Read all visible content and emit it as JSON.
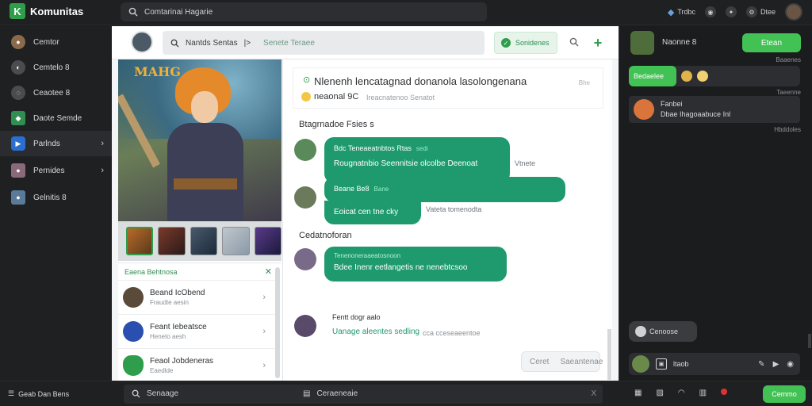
{
  "app": {
    "name": "Komunitas",
    "logo_glyph": "K"
  },
  "top_search": {
    "placeholder": "Comtarinai Hagarie"
  },
  "top_actions": [
    {
      "label": "Trdbc",
      "icon": "gamepad-icon"
    },
    {
      "label": "",
      "icon": "chat-icon"
    },
    {
      "label": "",
      "icon": "discover-icon"
    },
    {
      "label": "Dtee",
      "icon": "settings-icon"
    }
  ],
  "left_nav": [
    {
      "label": "Cemtor",
      "icon": "user-icon",
      "active": false
    },
    {
      "label": "Cemtelo 8",
      "icon": "chat-icon",
      "active": false
    },
    {
      "label": "Ceaotee 8",
      "icon": "star-icon",
      "active": false
    },
    {
      "label": "Daote Semde",
      "icon": "cube-icon",
      "active": false
    },
    {
      "label": "Parlnds",
      "icon": "game-icon",
      "active": true,
      "chevron": true
    },
    {
      "label": "Pernides",
      "icon": "avatar-icon",
      "active": false,
      "chevron": true
    },
    {
      "label": "Gelnitis 8",
      "icon": "avatar-icon",
      "active": false
    }
  ],
  "chat_header": {
    "title": "Nantds Sentas",
    "sep": "|>",
    "subtitle": "Senete Teraee",
    "green_button": "Sonidenes",
    "plus": "+"
  },
  "media": {
    "hero_title": "MAHG",
    "prompt": "Eaena Behtnosa",
    "contacts": [
      {
        "name": "Beand IcObend",
        "sub": "Fraudte aesin"
      },
      {
        "name": "Feant Iebeatsce",
        "sub": "Heneto aesh"
      },
      {
        "name": "Feaol Jobdeneras",
        "sub": "Eaedlde"
      }
    ]
  },
  "pinned": {
    "line1": "Nlenenh lencatagnad donanola lasolongenana",
    "line2": "neaonal 9C",
    "line2b": "Ireacnatenoo Senatot",
    "tag": "Bhe"
  },
  "messages": {
    "section1": "Btagrnadoe Fsies s",
    "bubble1_head": "Bdc",
    "bubble1_head2": "Teneaeatnbtos Rtas",
    "bubble1_tag": "sedi",
    "bubble1_text": "Rougnatnbio Seennitsie olcolbe Deenoat",
    "bubble1_meta": "Vtnete",
    "bubble2_head": "Beane Be8",
    "bubble2_tag": "Bane",
    "bubble2_text": "Eoicat cen tne cky",
    "bubble2_meta": "Vateta tomenodta",
    "section2": "Cedatnoforan",
    "bubble3_head": "Tenenoneraaeatosnoon",
    "bubble3_text": "Bdee Inenr eetlangetis ne nenebtcsoo",
    "reply_name": "Fentt dogr aalo",
    "reply_link": "Uanage aleentes sedling",
    "reply_meta": "cca cceseaeentoe",
    "send_left": "Ceret",
    "send_right": "Saeantenae"
  },
  "right": {
    "name": "Naonne 8",
    "button": "Etean",
    "time1": "Baaenes",
    "status_pill": "Bedaelee",
    "time2": "Taeenne",
    "notice_line1": "Fanbei",
    "notice_line2": "Dbae Ihagoaabuce Inl",
    "time3": "Hbddoles",
    "typing": "Cenoose",
    "input": "ltaob"
  },
  "bottom": {
    "left": "Geab Dan Bens",
    "search1": "Senaage",
    "search2": "Ceraeneaie",
    "search_close": "X",
    "button": "Cemmo"
  },
  "colors": {
    "accent": "#42c154",
    "bubble": "#1f9a6e",
    "sidebar": "#1f2022"
  }
}
